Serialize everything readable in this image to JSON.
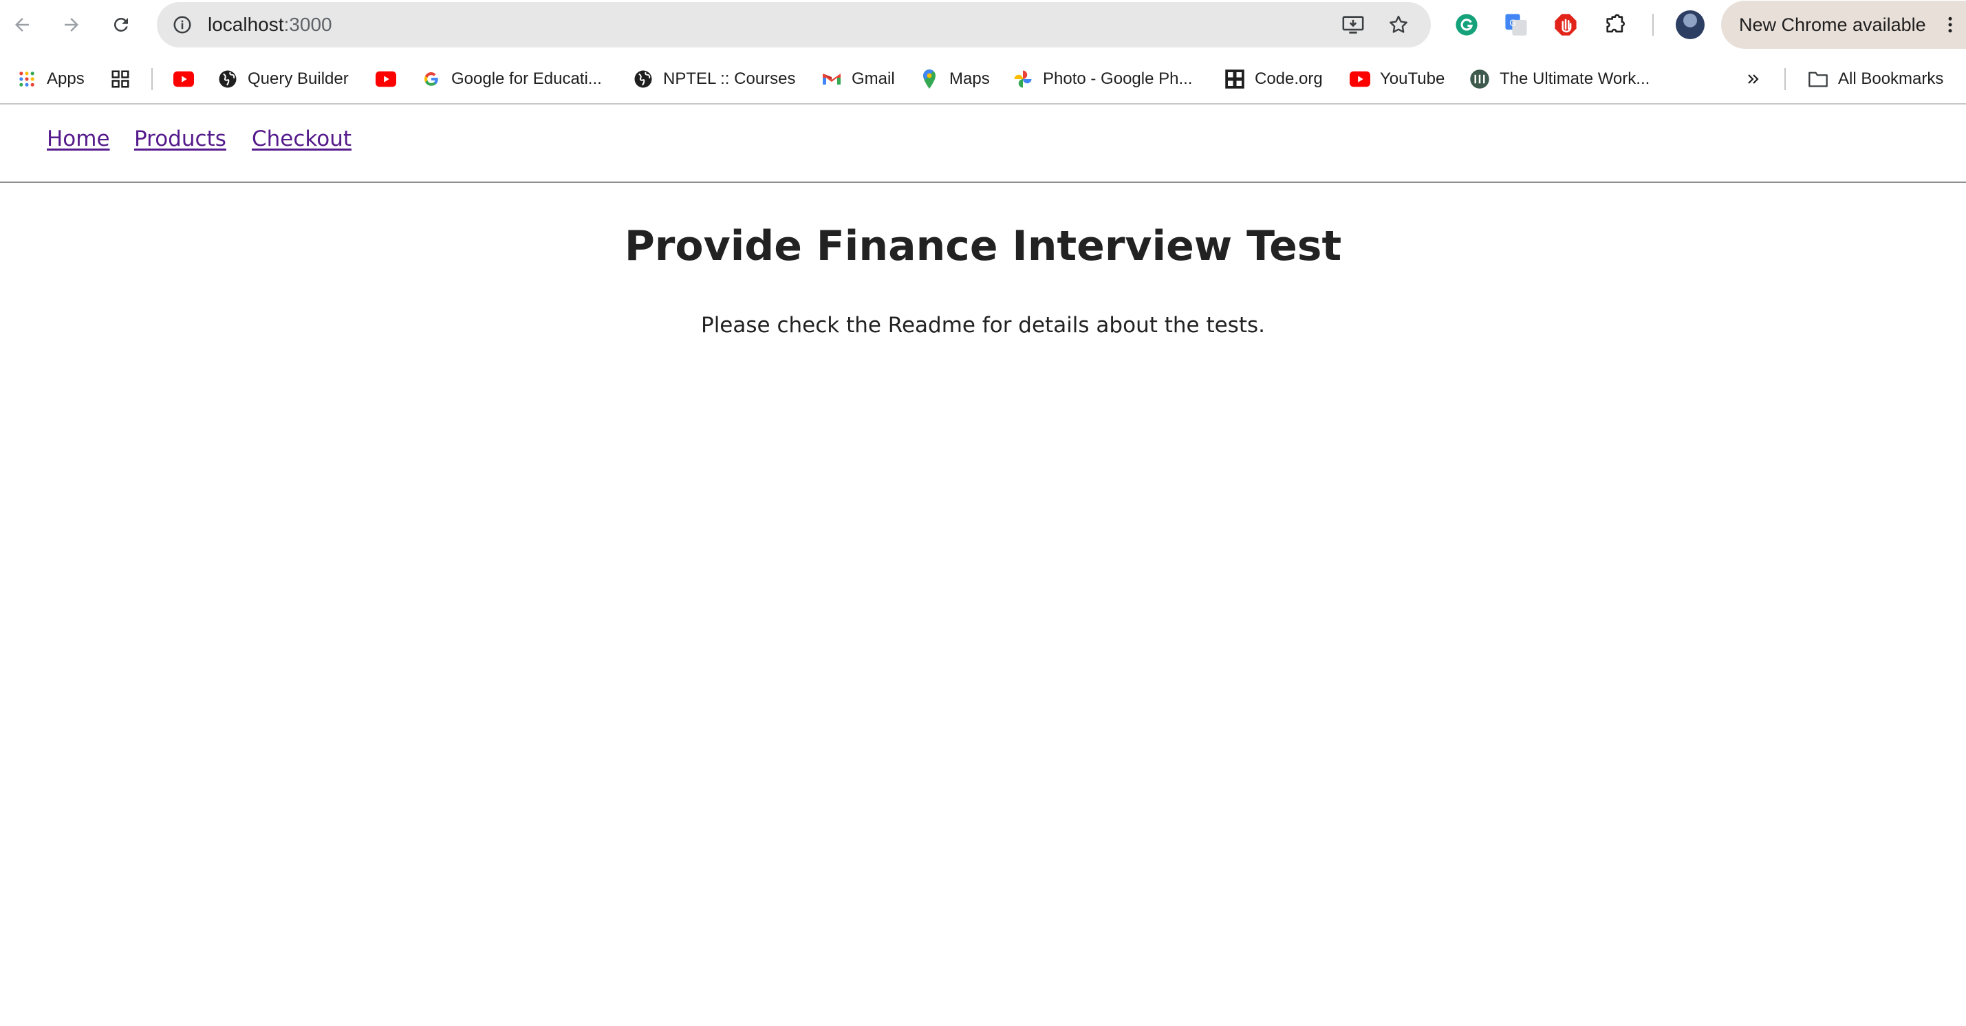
{
  "browser": {
    "url_host": "localhost",
    "url_port": ":3000",
    "update_button_label": "New Chrome available"
  },
  "bookmarks": {
    "apps_label": "Apps",
    "items": [
      {
        "label": "Query Builder",
        "icon": "globe-icon"
      },
      {
        "label": "Google for Educati...",
        "icon": "google-icon"
      },
      {
        "label": "NPTEL :: Courses",
        "icon": "globe-icon"
      },
      {
        "label": "Gmail",
        "icon": "gmail-icon"
      },
      {
        "label": "Maps",
        "icon": "maps-pin-icon"
      },
      {
        "label": "Photo - Google Ph...",
        "icon": "google-photos-icon"
      },
      {
        "label": "Code.org",
        "icon": "code-org-icon"
      },
      {
        "label": "YouTube",
        "icon": "youtube-icon"
      },
      {
        "label": "The Ultimate Work...",
        "icon": "site-logo-icon"
      }
    ],
    "all_bookmarks_label": "All Bookmarks"
  },
  "site_nav": {
    "links": [
      "Home",
      "Products",
      "Checkout"
    ]
  },
  "main": {
    "title": "Provide Finance Interview Test",
    "description": "Please check the Readme for details about the tests."
  },
  "colors": {
    "link_visited": "#551a8b",
    "text": "#222222",
    "omnibox_bg": "#e7e7e7",
    "update_chip_bg": "#e8dfd8"
  }
}
